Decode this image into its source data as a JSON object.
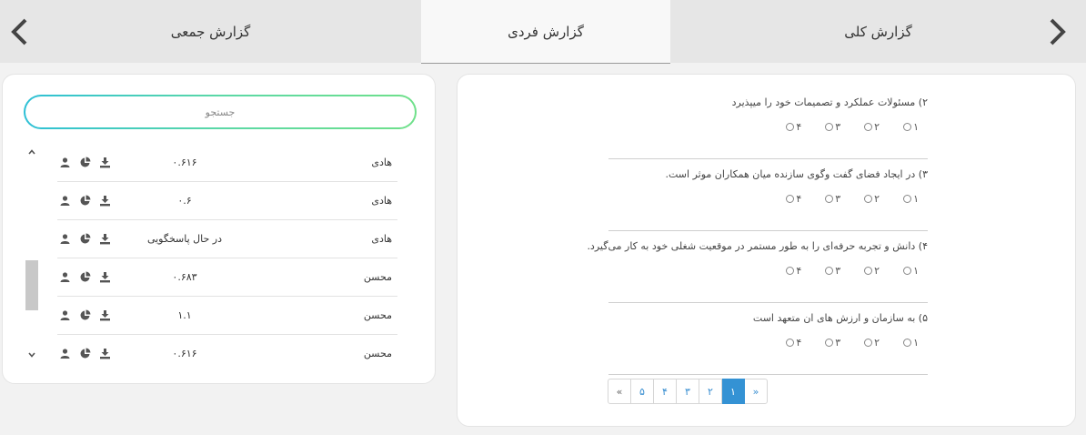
{
  "tabs": {
    "general": "گزارش کلی",
    "individual": "گزارش فردی",
    "group": "گزارش جمعی"
  },
  "search": {
    "placeholder": "جستجو"
  },
  "respondents": [
    {
      "name": "هادی",
      "score": "۰.۶۱۶"
    },
    {
      "name": "هادی",
      "score": "۰.۶"
    },
    {
      "name": "هادی",
      "score": "در حال پاسخگویی"
    },
    {
      "name": "محسن",
      "score": "۰.۶۸۳"
    },
    {
      "name": "محسن",
      "score": "۱.۱"
    },
    {
      "name": "محسن",
      "score": "۰.۶۱۶"
    }
  ],
  "questions": [
    {
      "text": "۲) مسئولات عملکرد و تصمیمات خود را میپذیرد",
      "options": [
        "۱",
        "۲",
        "۳",
        "۴"
      ]
    },
    {
      "text": "۳) در ایجاد فضای گفت وگوی سازنده میان همکاران موثر است.",
      "options": [
        "۱",
        "۲",
        "۳",
        "۴"
      ]
    },
    {
      "text": "۴) دانش و تجربه حرفه‌ای را به طور مستمر در موقعیت شغلی خود به کار می‌گیرد.",
      "options": [
        "۱",
        "۲",
        "۳",
        "۴"
      ]
    },
    {
      "text": "۵) به سازمان و ارزش های ان متعهد است",
      "options": [
        "۱",
        "۲",
        "۳",
        "۴"
      ]
    }
  ],
  "pagination": {
    "prev": "«",
    "pages": [
      "۱",
      "۲",
      "۳",
      "۴",
      "۵"
    ],
    "next": "»",
    "active_index": 0
  },
  "icons": {
    "row_actions": [
      "download-icon",
      "pie-chart-icon",
      "user-icon"
    ],
    "nav": [
      "chevron-left-icon",
      "chevron-right-icon"
    ]
  },
  "colors": {
    "active_page": "#3492d4",
    "search_border_start": "#2ec0d6",
    "search_border_end": "#6fe08a"
  }
}
